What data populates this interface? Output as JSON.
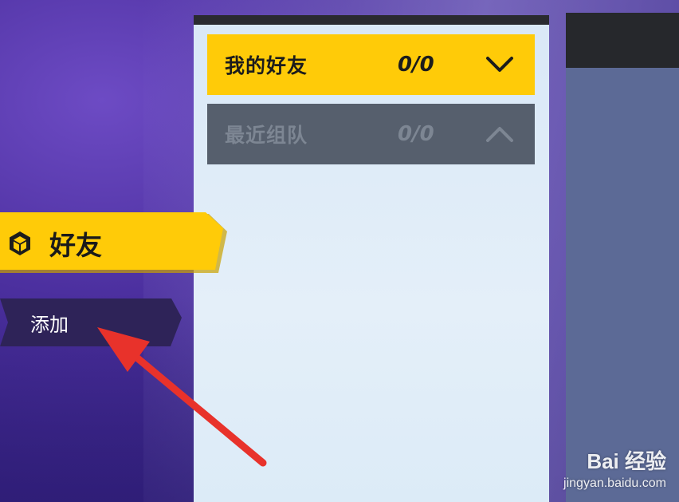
{
  "friends_panel": {
    "groups": [
      {
        "title": "我的好友",
        "count": "0/0",
        "state": "collapsed",
        "chevron": "chevron-down-icon",
        "color": "#ffcb08"
      },
      {
        "title": "最近组队",
        "count": "0/0",
        "state": "expanded",
        "chevron": "chevron-up-icon",
        "color": "#565f6d"
      }
    ]
  },
  "sidebar": {
    "friends_label": "好友",
    "friends_icon": "hexagon-cube-icon",
    "add_label": "添加"
  },
  "annotation": {
    "arrow_color": "#e8322b"
  },
  "watermark": {
    "brand": "Bai 经验",
    "url": "jingyan.baidu.com"
  }
}
